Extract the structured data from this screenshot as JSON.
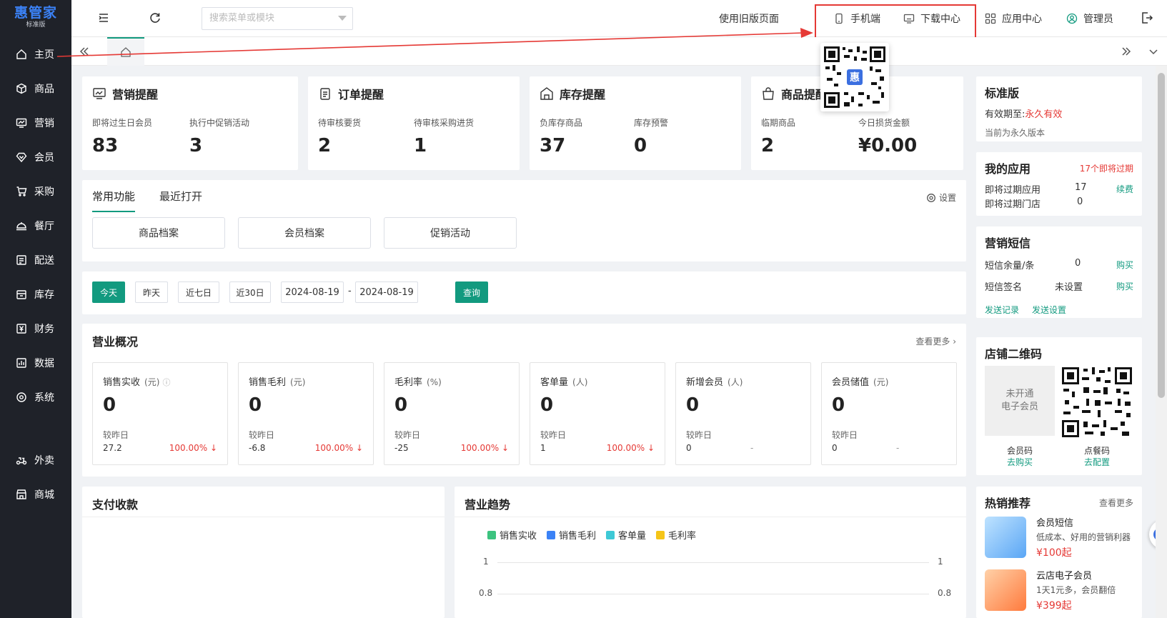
{
  "app": {
    "logo_name": "惠管家",
    "logo_edition": "标准版"
  },
  "sidebar": {
    "items": [
      {
        "label": "主页",
        "icon": "home-icon"
      },
      {
        "label": "商品",
        "icon": "cube-icon"
      },
      {
        "label": "营销",
        "icon": "chart-screen-icon"
      },
      {
        "label": "会员",
        "icon": "diamond-icon"
      },
      {
        "label": "采购",
        "icon": "cart-icon"
      },
      {
        "label": "餐厅",
        "icon": "dining-icon"
      },
      {
        "label": "配送",
        "icon": "delivery-icon"
      },
      {
        "label": "库存",
        "icon": "box-icon"
      },
      {
        "label": "财务",
        "icon": "yuan-icon"
      },
      {
        "label": "数据",
        "icon": "bar-chart-icon"
      },
      {
        "label": "系统",
        "icon": "gear-icon"
      },
      {
        "label": "外卖",
        "icon": "scooter-icon"
      },
      {
        "label": "商城",
        "icon": "shop-icon"
      }
    ]
  },
  "topbar": {
    "search_placeholder": "搜索菜单或模块",
    "old_version": "使用旧版页面",
    "mobile": "手机端",
    "download": "下载中心",
    "app_center": "应用中心",
    "admin": "管理员"
  },
  "reminders": [
    {
      "title": "营销提醒",
      "items": [
        {
          "label": "即将过生日会员",
          "value": "83"
        },
        {
          "label": "执行中促销活动",
          "value": "3"
        }
      ]
    },
    {
      "title": "订单提醒",
      "items": [
        {
          "label": "待审核要货",
          "value": "2"
        },
        {
          "label": "待审核采购进货",
          "value": "1"
        }
      ]
    },
    {
      "title": "库存提醒",
      "items": [
        {
          "label": "负库存商品",
          "value": "37"
        },
        {
          "label": "库存预警",
          "value": "0"
        }
      ]
    },
    {
      "title": "商品提醒",
      "items": [
        {
          "label": "临期商品",
          "value": "2"
        },
        {
          "label": "今日损货金额",
          "value": "¥0.00"
        }
      ]
    }
  ],
  "functions": {
    "tab_common": "常用功能",
    "tab_recent": "最近打开",
    "settings": "设置",
    "buttons": [
      "商品档案",
      "会员档案",
      "促销活动"
    ]
  },
  "date_filter": {
    "today": "今天",
    "yesterday": "昨天",
    "last7": "近七日",
    "last30": "近30日",
    "start": "2024-08-19",
    "sep": "-",
    "end": "2024-08-19",
    "query": "查询"
  },
  "overview": {
    "title": "营业概况",
    "more": "查看更多",
    "compare_label": "较昨日",
    "stats": [
      {
        "name": "销售实收",
        "unit": "(元)",
        "value": "0",
        "prev": "27.2",
        "pct": "100.00% ↓"
      },
      {
        "name": "销售毛利",
        "unit": "(元)",
        "value": "0",
        "prev": "-6.8",
        "pct": "100.00% ↓"
      },
      {
        "name": "毛利率",
        "unit": "(%)",
        "value": "0",
        "prev": "-25",
        "pct": "100.00% ↓"
      },
      {
        "name": "客单量",
        "unit": "(人)",
        "value": "0",
        "prev": "1",
        "pct": "100.00% ↓"
      },
      {
        "name": "新增会员",
        "unit": "(人)",
        "value": "0",
        "prev": "0",
        "pct": "-"
      },
      {
        "name": "会员储值",
        "unit": "(元)",
        "value": "0",
        "prev": "0",
        "pct": "-"
      }
    ]
  },
  "payment": {
    "title": "支付收款"
  },
  "trend": {
    "title": "营业趋势",
    "legend": [
      {
        "name": "销售实收",
        "color": "#3cc37f"
      },
      {
        "name": "销售毛利",
        "color": "#3b82f6"
      },
      {
        "name": "客单量",
        "color": "#3ec9d6"
      },
      {
        "name": "毛利率",
        "color": "#f5c518"
      }
    ],
    "y_ticks": [
      "1",
      "0.8"
    ]
  },
  "edition": {
    "title": "标准版",
    "valid_label": "有效期至:",
    "valid_value": "永久有效",
    "note": "当前为永久版本"
  },
  "my_apps": {
    "title": "我的应用",
    "badge": "17个即将过期",
    "rows": [
      {
        "label": "即将过期应用",
        "value": "17",
        "action": "续费"
      },
      {
        "label": "即将过期门店",
        "value": "0",
        "action": ""
      }
    ]
  },
  "sms": {
    "title": "营销短信",
    "rows": [
      {
        "label": "短信余量/条",
        "value": "0",
        "action": "购买"
      },
      {
        "label": "短信签名",
        "value": "未设置",
        "action": "购买"
      }
    ],
    "send_records": "发送记录",
    "send_settings": "发送设置"
  },
  "store_qr": {
    "title": "店铺二维码",
    "placeholder_line1": "未开通",
    "placeholder_line2": "电子会员",
    "member_code": "会员码",
    "member_action": "去购买",
    "order_code": "点餐码",
    "order_action": "去配置"
  },
  "hot": {
    "title": "热销推荐",
    "more": "查看更多",
    "items": [
      {
        "name": "会员短信",
        "desc": "低成本、好用的营销利器",
        "price": "¥100起"
      },
      {
        "name": "云店电子会员",
        "desc": "1天1元多，会员翻倍",
        "price": "¥399起"
      }
    ]
  }
}
